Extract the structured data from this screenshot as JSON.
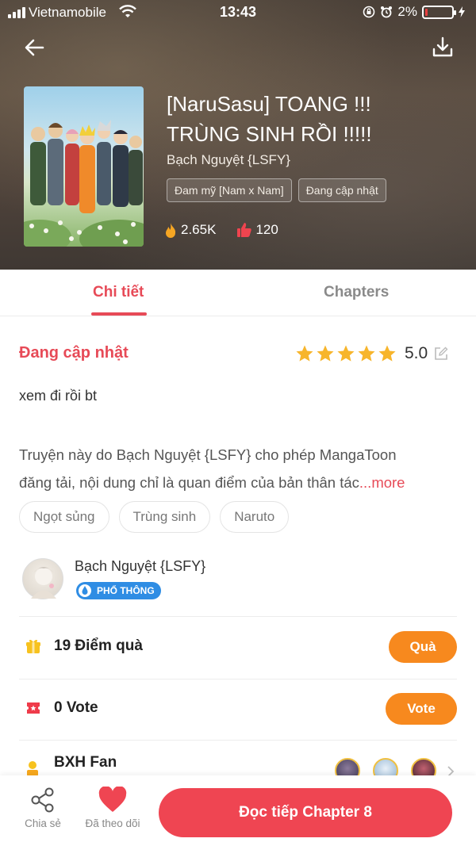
{
  "status_bar": {
    "carrier": "Vietnamobile",
    "time": "13:43",
    "battery": "2%"
  },
  "manga": {
    "title_line1": "[NaruSasu] TOANG !!!",
    "title_line2": "TRÙNG SINH RỒI !!!!!",
    "author": "Bạch Nguyệt {LSFY}",
    "tags": [
      "Đam mỹ [Nam x Nam]",
      "Đang cập nhật"
    ],
    "views": "2.65K",
    "likes": "120"
  },
  "tabs": {
    "detail": "Chi tiết",
    "chapters": "Chapters"
  },
  "detail": {
    "status": "Đang cập nhật",
    "rating": "5.0",
    "stars": 5,
    "summary": "xem đi rồi bt",
    "copyright_line1": "Truyện này do Bạch Nguyệt {LSFY} cho phép MangaToon",
    "copyright_line2": "đăng tải, nội dung chỉ là quan điểm của bản thân tác",
    "more": "...more",
    "genres": [
      "Ngọt sủng",
      "Trùng sinh",
      "Naruto"
    ]
  },
  "author_card": {
    "name": "Bạch Nguyệt {LSFY}",
    "badge": "PHỔ THÔNG"
  },
  "gift": {
    "text": "19 Điểm quà",
    "button": "Quà"
  },
  "vote": {
    "text": "0 Vote",
    "button": "Vote"
  },
  "fan": {
    "title": "BXH Fan"
  },
  "bottom": {
    "share": "Chia sẻ",
    "follow": "Đã theo dõi",
    "read": "Đọc tiếp Chapter 8"
  },
  "colors": {
    "accent": "#e74a57",
    "orange": "#f7891e",
    "read_button": "#ef4552",
    "badge_blue": "#2f8de4"
  }
}
